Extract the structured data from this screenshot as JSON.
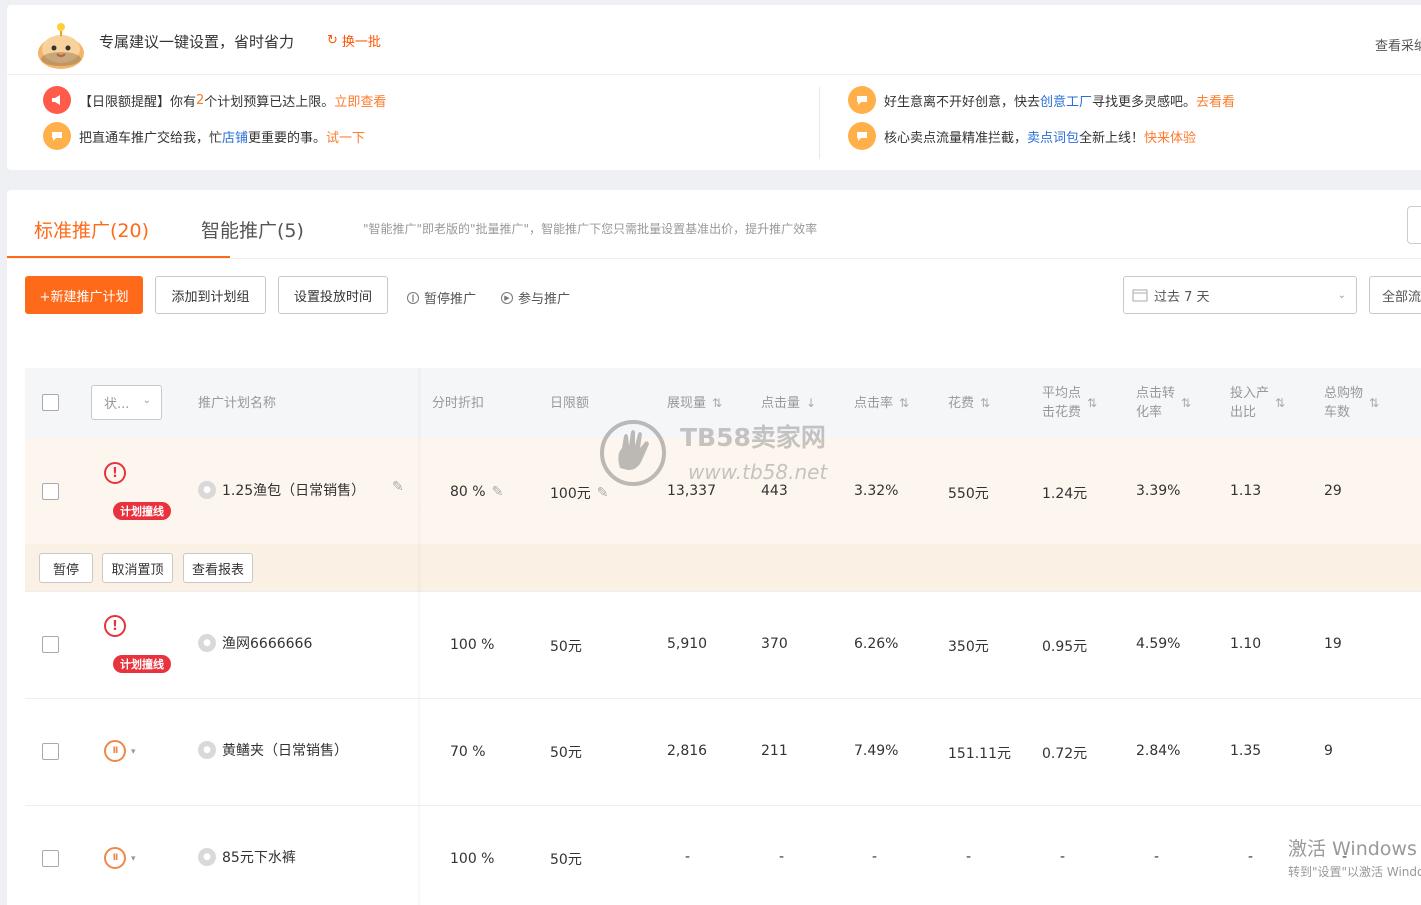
{
  "header": {
    "title": "专属建议一键设置，省时省力",
    "refresh_label": "换一批",
    "right_link": "查看采纳"
  },
  "notices": {
    "left": [
      {
        "pre": "【日限额提醒】你有",
        "highlight": "2",
        "mid": "个计划预算已达上限。",
        "link": "立即查看",
        "icon": "megaphone-icon",
        "color": "#ff5a4a"
      },
      {
        "pre": "把直通车推广交给我，忙",
        "highlight": "店铺",
        "mid": "更重要的事。",
        "link": "试一下",
        "icon": "chat-icon",
        "color": "#ffb04a"
      }
    ],
    "right": [
      {
        "pre": "好生意离不开好创意，快去",
        "highlight": "创意工厂",
        "mid": "寻找更多灵感吧。",
        "link": "去看看",
        "icon": "chat-icon",
        "color": "#ffb04a"
      },
      {
        "pre": "核心卖点流量精准拦截，",
        "highlight": "卖点词包",
        "mid": "全新上线！",
        "link": "快来体验",
        "icon": "chat-icon",
        "color": "#ffb04a"
      }
    ]
  },
  "tabs": {
    "standard": "标准推广(20)",
    "smart": "智能推广(5)",
    "hint": "\"智能推广\"即老版的\"批量推广\"，智能推广下您只需批量设置基准出价，提升推广效率"
  },
  "toolbar": {
    "new_plan": "+新建推广计划",
    "add_group": "添加到计划组",
    "set_time": "设置投放时间",
    "pause": "暂停推广",
    "join": "参与推广",
    "date_range": "过去 7 天",
    "all_label": "全部流"
  },
  "table": {
    "status_placeholder": "状...",
    "headers": {
      "name": "推广计划名称",
      "discount": "分时折扣",
      "daily_limit": "日限额",
      "impressions": "展现量",
      "clicks": "点击量",
      "ctr": "点击率",
      "cost": "花费",
      "avg_cpc_1": "平均点",
      "avg_cpc_2": "击花费",
      "cvr_1": "点击转",
      "cvr_2": "化率",
      "roi_1": "投入产",
      "roi_2": "出比",
      "cart_1": "总购物",
      "cart_2": "车数"
    },
    "rows": [
      {
        "name": "1.25渔包（日常销售）",
        "badge": "计划撞线",
        "status": "warning",
        "discount": "80 %",
        "daily_limit": "100元",
        "impressions": "13,337",
        "clicks": "443",
        "ctr": "3.32%",
        "cost": "550元",
        "avg_cpc": "1.24元",
        "cvr": "3.39%",
        "roi": "1.13",
        "cart": "29"
      },
      {
        "name": "渔网6666666",
        "badge": "计划撞线",
        "status": "warning",
        "discount": "100 %",
        "daily_limit": "50元",
        "impressions": "5,910",
        "clicks": "370",
        "ctr": "6.26%",
        "cost": "350元",
        "avg_cpc": "0.95元",
        "cvr": "4.59%",
        "roi": "1.10",
        "cart": "19"
      },
      {
        "name": "黄鳝夹（日常销售）",
        "badge": "",
        "status": "paused",
        "discount": "70 %",
        "daily_limit": "50元",
        "impressions": "2,816",
        "clicks": "211",
        "ctr": "7.49%",
        "cost": "151.11元",
        "avg_cpc": "0.72元",
        "cvr": "2.84%",
        "roi": "1.35",
        "cart": "9"
      },
      {
        "name": "85元下水裤",
        "badge": "",
        "status": "paused",
        "discount": "100 %",
        "daily_limit": "50元",
        "impressions": "-",
        "clicks": "-",
        "ctr": "-",
        "cost": "-",
        "avg_cpc": "-",
        "cvr": "-",
        "roi": "-",
        "cart": "-"
      }
    ],
    "row_actions": {
      "pause": "暂停",
      "unpin": "取消置顶",
      "report": "查看报表"
    }
  },
  "watermark": {
    "brand": "TB58卖家网",
    "url": "www.tb58.net"
  },
  "os_activation": {
    "line1": "激活 Windows",
    "line2": "转到\"设置\"以激活 Windows"
  },
  "colors": {
    "accent": "#ff6a1a",
    "warning": "#e8333e",
    "link_blue": "#2a6fd6"
  }
}
